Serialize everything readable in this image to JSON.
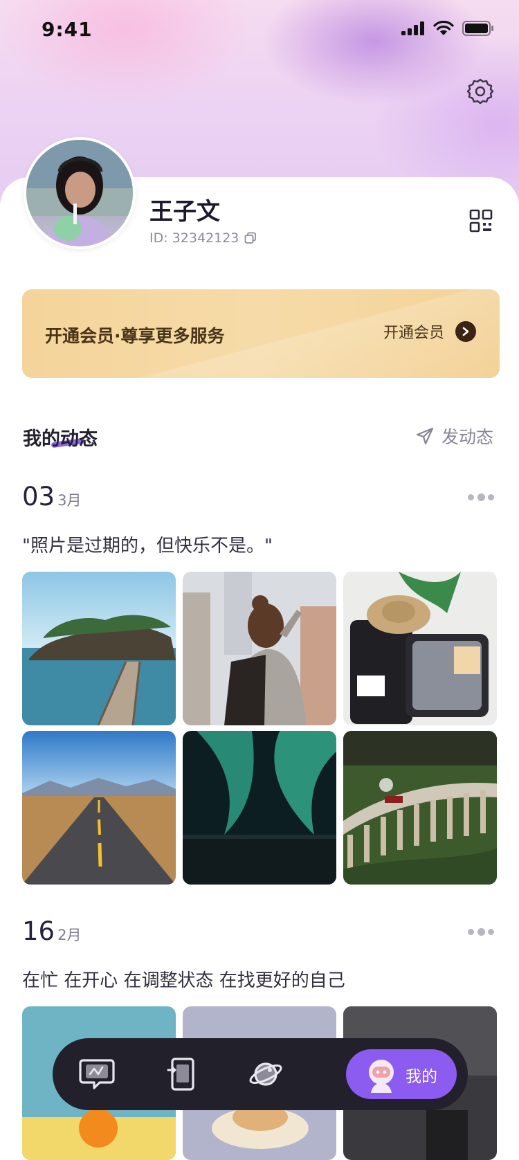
{
  "status_bar": {
    "time": "9:41",
    "icons": [
      "signal-icon",
      "wifi-icon",
      "battery-icon"
    ]
  },
  "header": {
    "settings_icon": "gear-icon"
  },
  "profile": {
    "name": "王子文",
    "id_label": "ID: 32342123",
    "copy_icon": "copy-icon",
    "qr_icon": "qr-code-icon"
  },
  "vip_banner": {
    "text": "开通会员·尊享更多服务",
    "action_label": "开通会员"
  },
  "moments": {
    "title": "我的动态",
    "post_label": "发动态"
  },
  "posts": [
    {
      "day": "03",
      "month": "3月",
      "text": "\"照片是过期的，但快乐不是。\""
    },
    {
      "day": "16",
      "month": "2月",
      "text": "在忙 在开心 在调整状态 在找更好的自己"
    }
  ],
  "tabbar": {
    "items": [
      "chat-icon",
      "phone-icon",
      "planet-icon"
    ],
    "active_label": "我的"
  },
  "colors": {
    "accent": "#8c5cf0",
    "vip_gold": "#f4d49a",
    "tabbar_bg": "#22202a"
  }
}
